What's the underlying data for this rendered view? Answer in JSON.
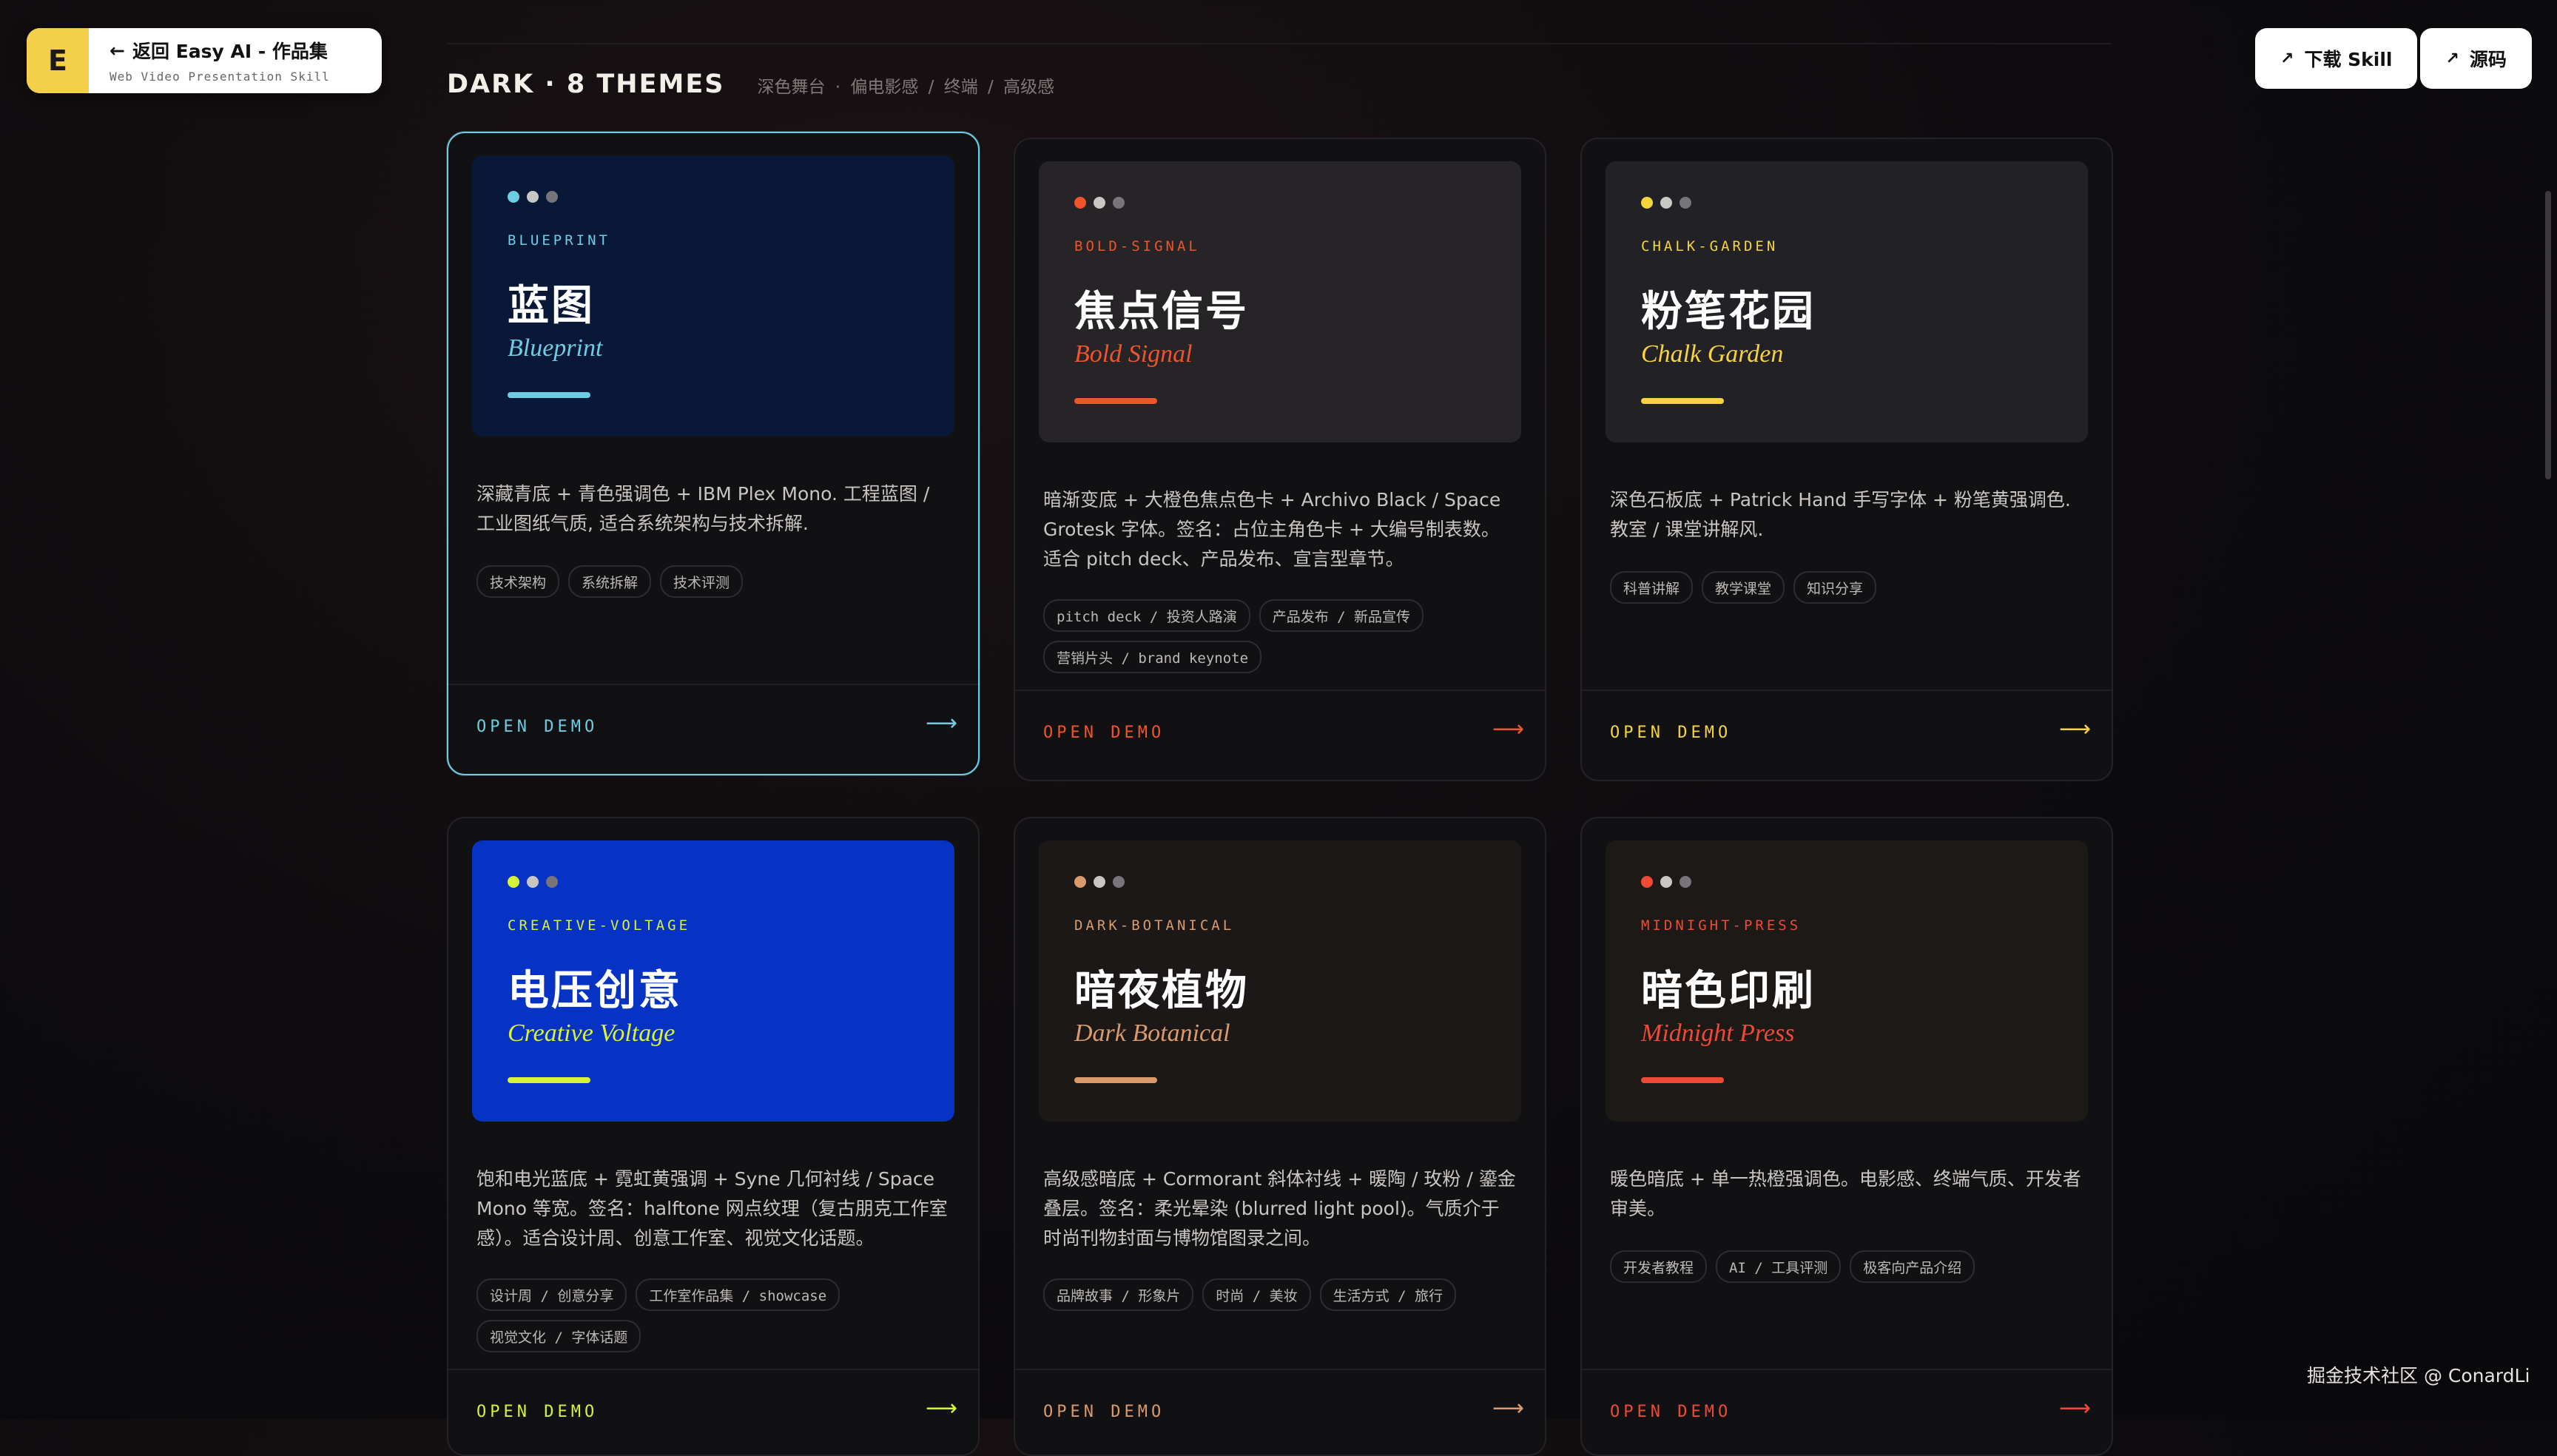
{
  "header": {
    "logo_letter": "E",
    "back_title": "返回 Easy AI - 作品集",
    "back_subtitle": "Web Video Presentation Skill",
    "download_label": "下载 Skill",
    "source_label": "源码"
  },
  "section": {
    "title": "DARK · 8 THEMES",
    "subtitle": "深色舞台 · 偏电影感 / 终端 / 高级感"
  },
  "cards": [
    {
      "code": "BLUEPRINT",
      "zh": "蓝图",
      "en": "Blueprint",
      "desc": "深藏青底 + 青色强调色 + IBM Plex Mono. 工程蓝图 / 工业图纸气质, 适合系统架构与技术拆解.",
      "tags": [
        "技术架构",
        "系统拆解",
        "技术评测"
      ],
      "open": "OPEN DEMO",
      "arrow": "⟶",
      "accent": "#6fcde3",
      "hero_bg": "#0a1838",
      "selected": true
    },
    {
      "code": "BOLD-SIGNAL",
      "zh": "焦点信号",
      "en": "Bold Signal",
      "desc": "暗渐变底 + 大橙色焦点色卡 + Archivo Black / Space Grotesk 字体。签名：占位主角色卡 + 大编号制表数。适合 pitch deck、产品发布、宣言型章节。",
      "tags": [
        "pitch deck / 投资人路演",
        "产品发布 / 新品宣传",
        "营销片头 / brand keynote"
      ],
      "open": "OPEN DEMO",
      "arrow": "⟶",
      "accent": "#f0542a",
      "hero_bg": "#262427",
      "selected": false
    },
    {
      "code": "CHALK-GARDEN",
      "zh": "粉笔花园",
      "en": "Chalk Garden",
      "desc": "深色石板底 + Patrick Hand 手写字体 + 粉笔黄强调色. 教室 / 课堂讲解风.",
      "tags": [
        "科普讲解",
        "教学课堂",
        "知识分享"
      ],
      "open": "OPEN DEMO",
      "arrow": "⟶",
      "accent": "#f6d43c",
      "hero_bg": "#222125",
      "selected": false
    },
    {
      "code": "CREATIVE-VOLTAGE",
      "zh": "电压创意",
      "en": "Creative Voltage",
      "desc": "饱和电光蓝底 + 霓虹黄强调 + Syne 几何衬线 / Space Mono 等宽。签名：halftone 网点纹理（复古朋克工作室感）。适合设计周、创意工作室、视觉文化话题。",
      "tags": [
        "设计周 / 创意分享",
        "工作室作品集 / showcase",
        "视觉文化 / 字体话题"
      ],
      "open": "OPEN DEMO",
      "arrow": "⟶",
      "accent": "#d8f23a",
      "hero_bg": "#0633c4",
      "selected": false
    },
    {
      "code": "DARK-BOTANICAL",
      "zh": "暗夜植物",
      "en": "Dark Botanical",
      "desc": "高级感暗底 + Cormorant 斜体衬线 + 暖陶 / 玫粉 / 鎏金叠层。签名：柔光晕染 (blurred light pool)。气质介于时尚刊物封面与博物馆图录之间。",
      "tags": [
        "品牌故事 / 形象片",
        "时尚 / 美妆",
        "生活方式 / 旅行"
      ],
      "open": "OPEN DEMO",
      "arrow": "⟶",
      "accent": "#d99a6c",
      "hero_bg": "#1b1817",
      "selected": false
    },
    {
      "code": "MIDNIGHT-PRESS",
      "zh": "暗色印刷",
      "en": "Midnight Press",
      "desc": "暖色暗底 + 单一热橙强调色。电影感、终端气质、开发者审美。",
      "tags": [
        "开发者教程",
        "AI / 工具评测",
        "极客向产品介绍"
      ],
      "open": "OPEN DEMO",
      "arrow": "⟶",
      "accent": "#ef4a36",
      "hero_bg": "#1d1916",
      "selected": false
    }
  ],
  "watermark": "掘金技术社区 @ ConardLi"
}
